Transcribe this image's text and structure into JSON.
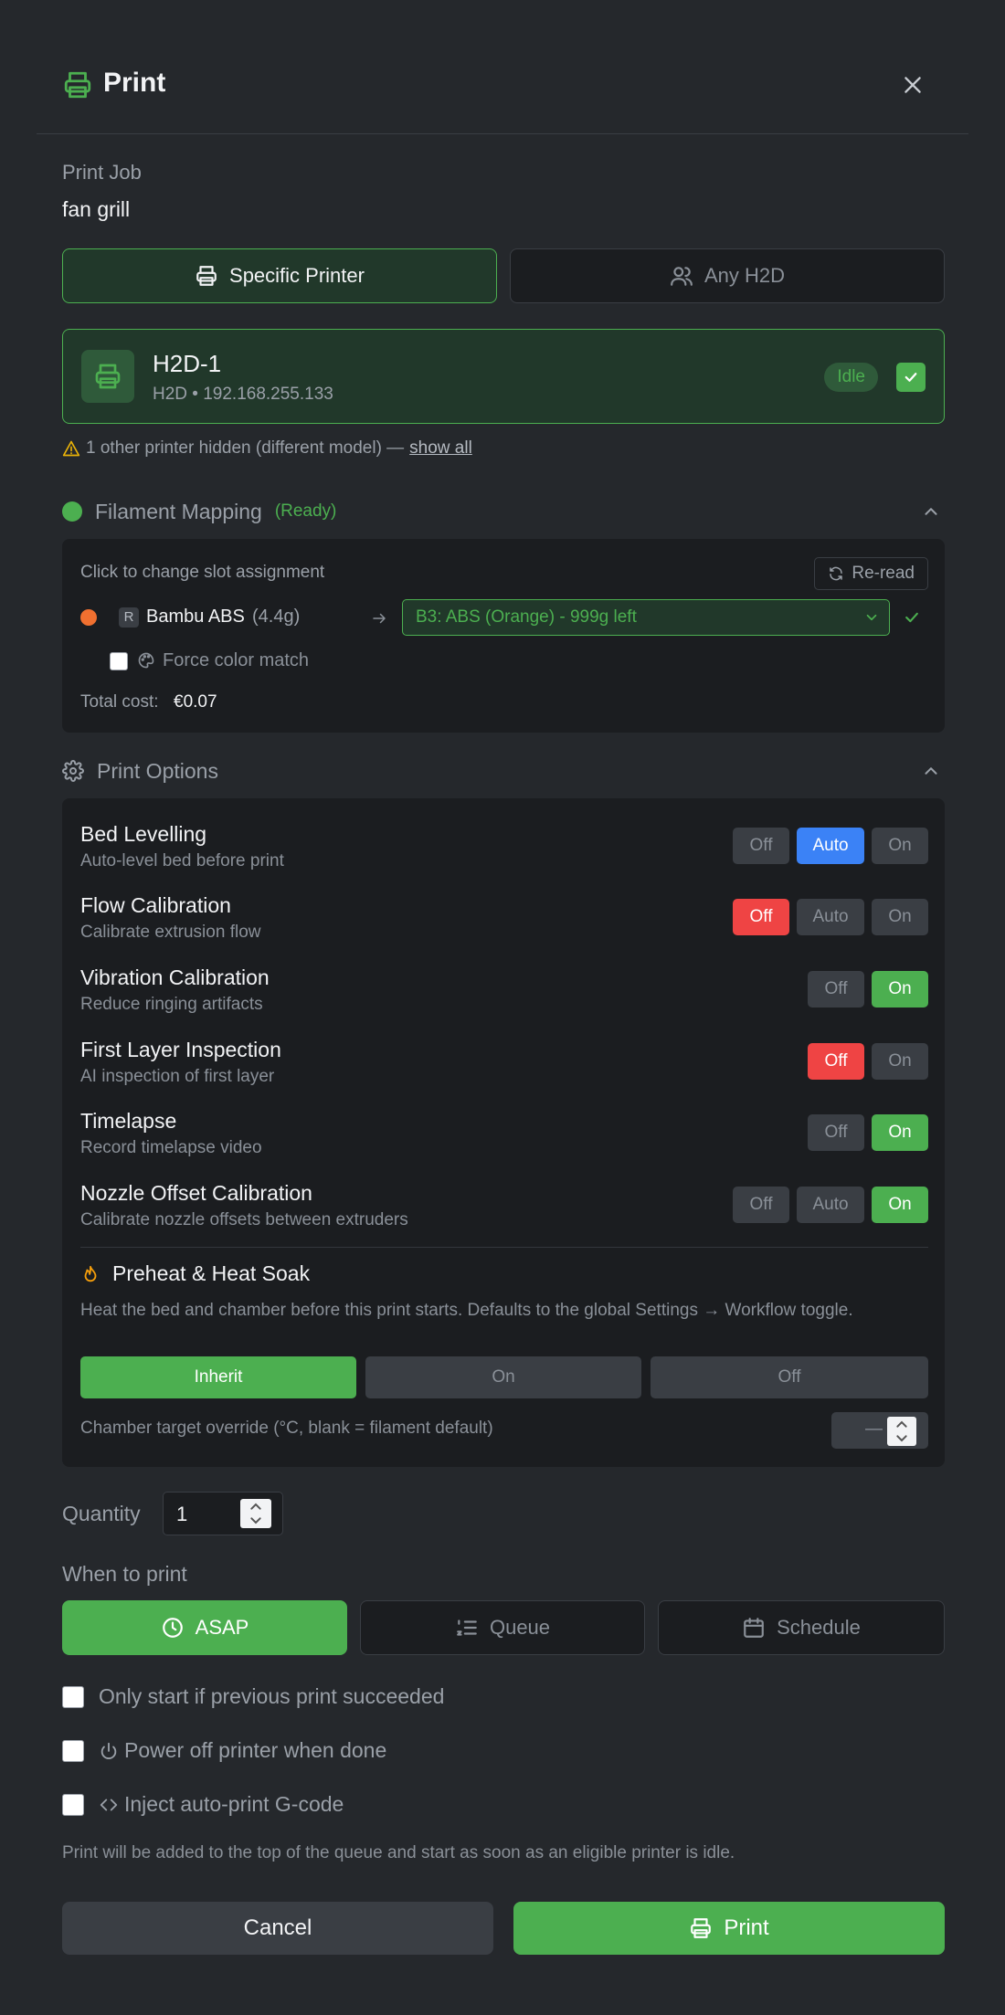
{
  "header": {
    "title": "Print",
    "icon": "printer-icon"
  },
  "job": {
    "label": "Print Job",
    "name": "fan grill"
  },
  "target_modes": [
    {
      "label": "Specific Printer",
      "icon": "printer-icon",
      "active": true
    },
    {
      "label": "Any H2D",
      "icon": "users-icon",
      "active": false
    }
  ],
  "printer": {
    "name": "H2D-1",
    "subtitle": "H2D • 192.168.255.133",
    "status": "Idle",
    "selected": true
  },
  "hidden_notice": {
    "text": "1 other printer hidden (different model) —",
    "link": "show all"
  },
  "filament": {
    "title": "Filament Mapping",
    "status": "(Ready)",
    "hint": "Click to change slot assignment",
    "reread_label": "Re-read",
    "item": {
      "badge": "R",
      "name": "Bambu ABS",
      "weight": "(4.4g)",
      "color": "#f07030"
    },
    "slot": "B3: ABS (Orange) - 999g left",
    "force_color_label": "Force color match",
    "total_cost_label": "Total cost:",
    "total_cost_value": "€0.07"
  },
  "print_options": {
    "title": "Print Options",
    "rows": [
      {
        "title": "Bed Levelling",
        "desc": "Auto-level bed before print",
        "buttons": [
          "Off",
          "Auto",
          "On"
        ],
        "selected": "Auto"
      },
      {
        "title": "Flow Calibration",
        "desc": "Calibrate extrusion flow",
        "buttons": [
          "Off",
          "Auto",
          "On"
        ],
        "selected": "Off"
      },
      {
        "title": "Vibration Calibration",
        "desc": "Reduce ringing artifacts",
        "buttons": [
          "Off",
          "On"
        ],
        "selected": "On"
      },
      {
        "title": "First Layer Inspection",
        "desc": "AI inspection of first layer",
        "buttons": [
          "Off",
          "On"
        ],
        "selected": "Off"
      },
      {
        "title": "Timelapse",
        "desc": "Record timelapse video",
        "buttons": [
          "Off",
          "On"
        ],
        "selected": "On"
      },
      {
        "title": "Nozzle Offset Calibration",
        "desc": "Calibrate nozzle offsets between extruders",
        "buttons": [
          "Off",
          "Auto",
          "On"
        ],
        "selected": "On"
      }
    ],
    "preheat": {
      "title": "Preheat & Heat Soak",
      "desc": "Heat the bed and chamber before this print starts. Defaults to the global Settings → Workflow toggle.",
      "buttons": [
        "Inherit",
        "On",
        "Off"
      ],
      "selected": "Inherit",
      "chamber_label": "Chamber target override (°C, blank = filament default)",
      "chamber_placeholder": "—"
    }
  },
  "quantity": {
    "label": "Quantity",
    "value": "1"
  },
  "when": {
    "label": "When to print",
    "options": [
      {
        "label": "ASAP",
        "icon": "clock-icon",
        "active": true
      },
      {
        "label": "Queue",
        "icon": "list-order-icon",
        "active": false
      },
      {
        "label": "Schedule",
        "icon": "calendar-icon",
        "active": false
      }
    ]
  },
  "checks": {
    "only_if_success": "Only start if previous print succeeded",
    "power_off": "Power off printer when done",
    "inject_gcode": "Inject auto-print G-code"
  },
  "info_text": "Print will be added to the top of the queue and start as soon as an eligible printer is idle.",
  "footer": {
    "cancel": "Cancel",
    "print": "Print"
  },
  "colors": {
    "accent": "#4caf50",
    "blue": "#3b82f6",
    "red": "#ef4444",
    "background": "#25282c",
    "panel": "#1b1d20"
  }
}
